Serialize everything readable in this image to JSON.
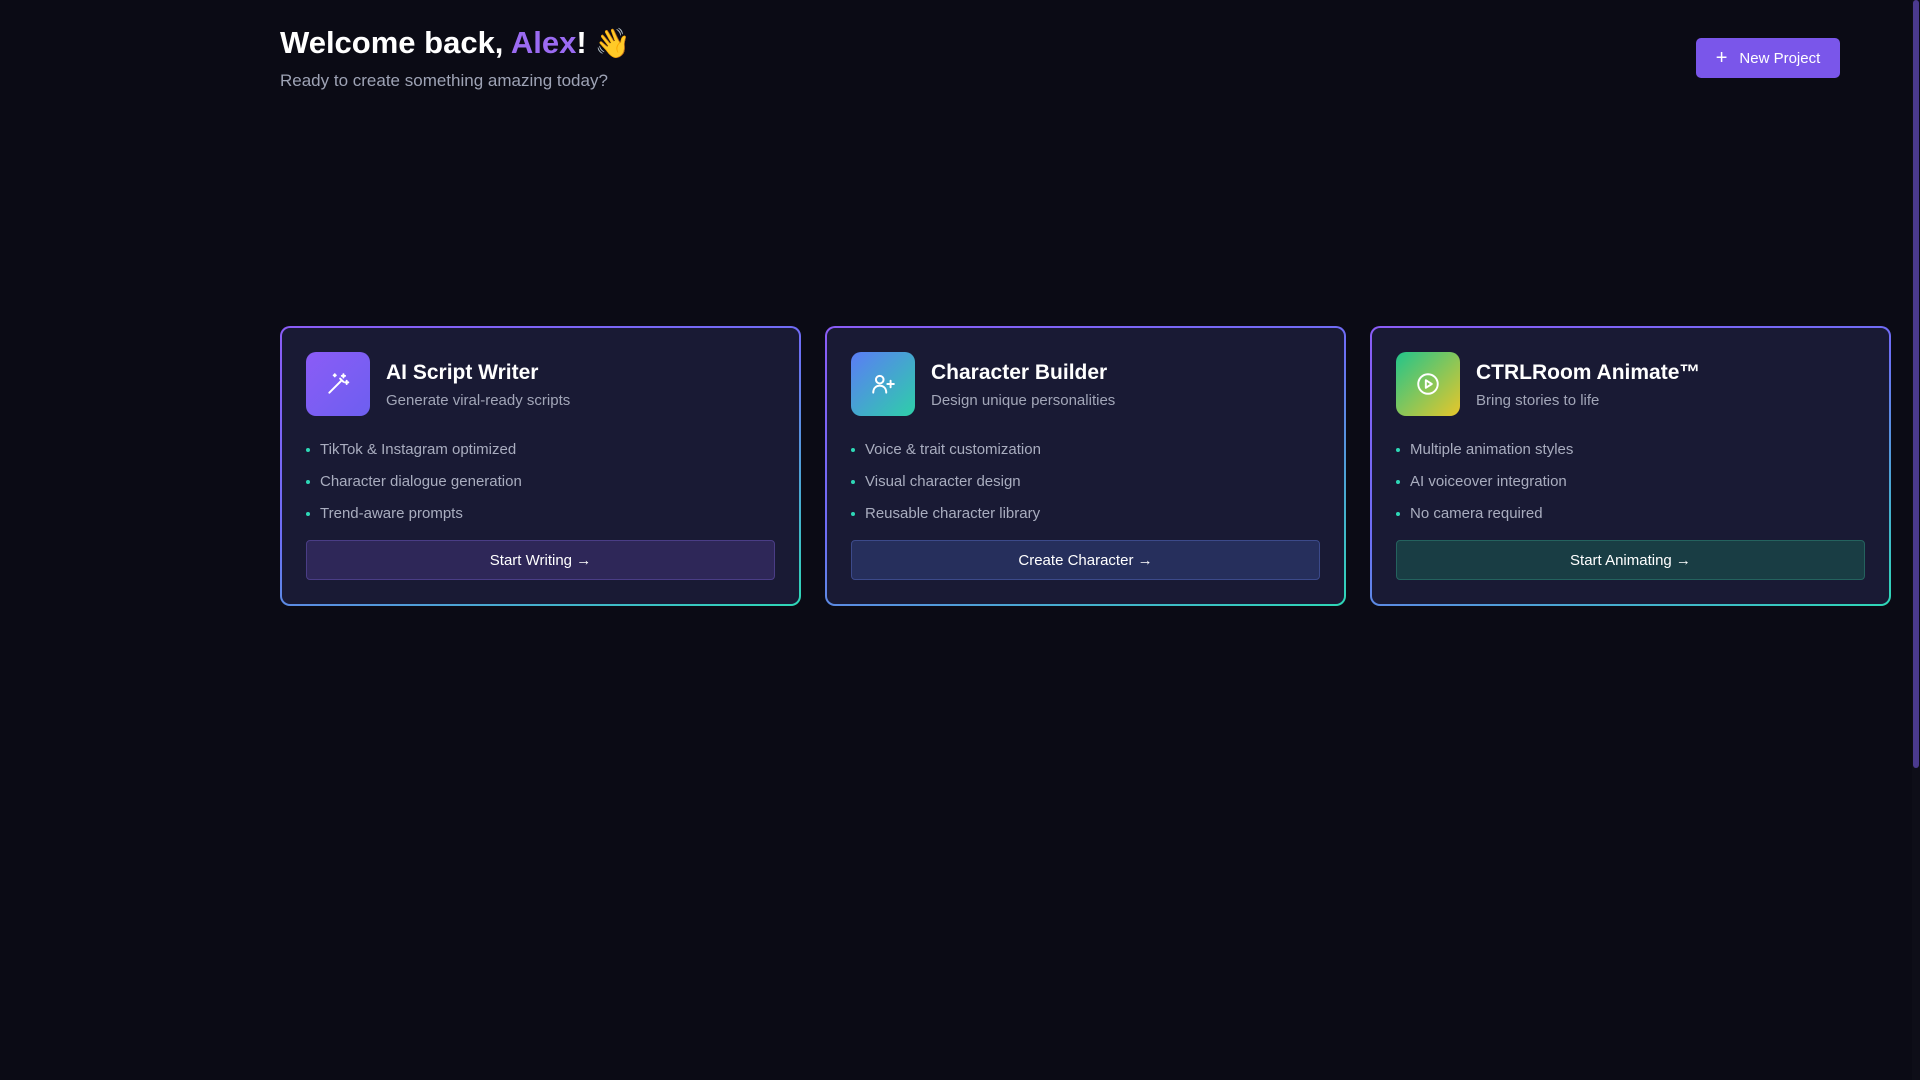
{
  "header": {
    "welcome_prefix": "Welcome back, ",
    "user_name": "Alex",
    "welcome_suffix": "!",
    "wave_emoji": "👋",
    "subtitle": "Ready to create something amazing today?"
  },
  "toolbar": {
    "new_project_icon": "+",
    "new_project_label": "New Project"
  },
  "colors": {
    "background": "#0b0b15",
    "accent": "#7a56ea",
    "highlight_name": "#9b6bf2",
    "bullet": "#2ed8b6"
  },
  "cards": [
    {
      "icon": "magic-wand-icon",
      "title": "AI Script Writer",
      "subtitle": "Generate viral-ready scripts",
      "features": [
        "TikTok & Instagram optimized",
        "Character dialogue generation",
        "Trend-aware prompts"
      ],
      "button_label": "Start Writing →"
    },
    {
      "icon": "user-plus-icon",
      "title": "Character Builder",
      "subtitle": "Design unique personalities",
      "features": [
        "Voice & trait customization",
        "Visual character design",
        "Reusable character library"
      ],
      "button_label": "Create Character →"
    },
    {
      "icon": "play-circle-icon",
      "title": "CTRLRoom Animate™",
      "subtitle": "Bring stories to life",
      "features": [
        "Multiple animation styles",
        "AI voiceover integration",
        "No camera required"
      ],
      "button_label": "Start Animating →"
    }
  ]
}
